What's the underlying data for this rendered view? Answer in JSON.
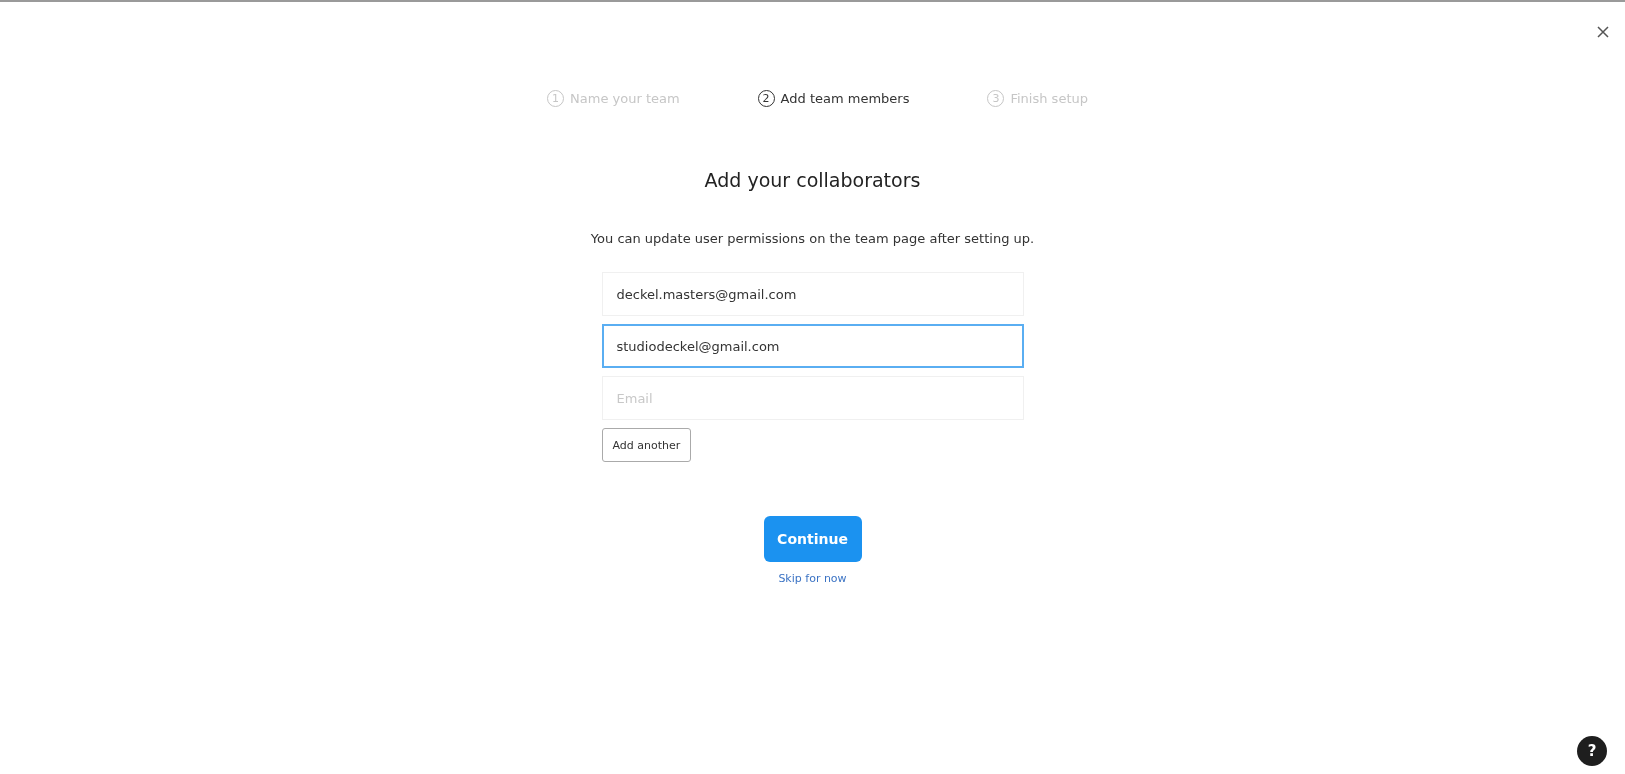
{
  "steps": [
    {
      "number": "1",
      "label": "Name your team",
      "selected": false
    },
    {
      "number": "2",
      "label": "Add team members",
      "selected": true
    },
    {
      "number": "3",
      "label": "Finish setup",
      "selected": false
    }
  ],
  "title": "Add your collaborators",
  "subtitle": "You can update user permissions on the team page after setting up.",
  "emails": [
    {
      "value": "deckel.masters@gmail.com",
      "focused": false
    },
    {
      "value": "studiodeckel@gmail.com",
      "focused": true
    },
    {
      "placeholder": "Email",
      "focused": false
    }
  ],
  "add_button": "Add another",
  "continue_button": "Continue",
  "skip_link": "Skip for now",
  "help_button": "?"
}
